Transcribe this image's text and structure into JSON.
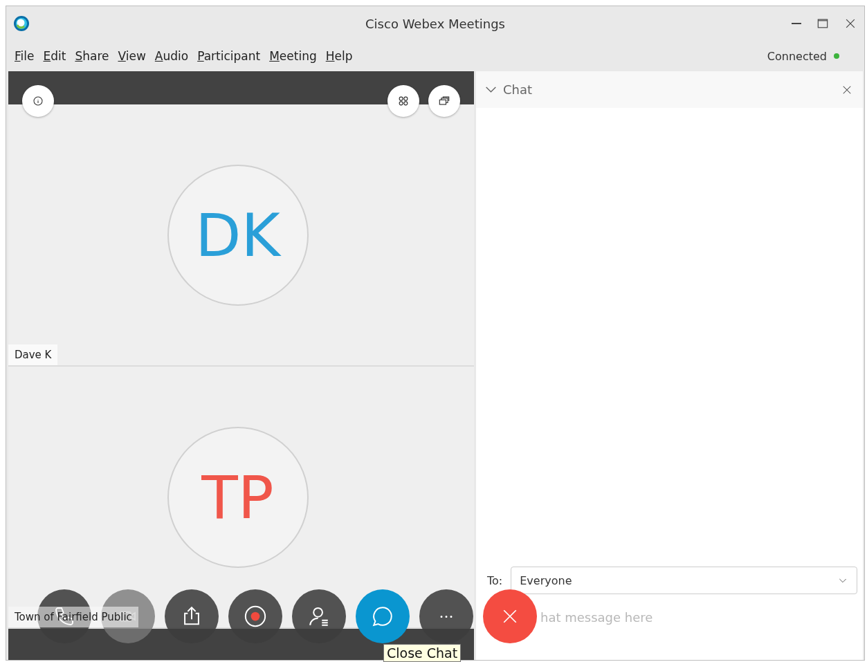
{
  "window": {
    "title": "Cisco Webex Meetings"
  },
  "menu": [
    {
      "label": "File"
    },
    {
      "label": "Edit"
    },
    {
      "label": "Share"
    },
    {
      "label": "View"
    },
    {
      "label": "Audio"
    },
    {
      "label": "Participant"
    },
    {
      "label": "Meeting"
    },
    {
      "label": "Help"
    }
  ],
  "status": {
    "label": "Connected",
    "color": "#3db33d"
  },
  "participants": [
    {
      "initials": "DK",
      "name": "Dave K",
      "color": "#2a9fd8"
    },
    {
      "initials": "TP",
      "name": "Town of Fairfield Public",
      "color": "#f0564a"
    }
  ],
  "controls": [
    {
      "kind": "phone",
      "active": false
    },
    {
      "kind": "video",
      "active": false
    },
    {
      "kind": "share",
      "active": false
    },
    {
      "kind": "record",
      "active": false
    },
    {
      "kind": "participants",
      "active": false
    },
    {
      "kind": "chat",
      "active": true
    },
    {
      "kind": "more",
      "active": false
    },
    {
      "kind": "leave",
      "active": false
    }
  ],
  "tooltip": "Close Chat",
  "chat": {
    "title": "Chat",
    "to_label": "To:",
    "to_value": "Everyone",
    "placeholder": "hat message here"
  }
}
